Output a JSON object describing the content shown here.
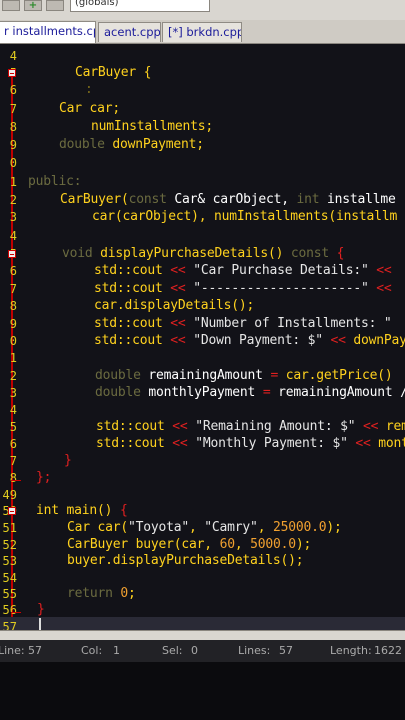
{
  "toolbar": {
    "globals_label": "(globals)"
  },
  "tabs": [
    {
      "label": "r installments.cpp",
      "active": true
    },
    {
      "label": "acent.cpp",
      "active": false
    },
    {
      "label": "[*] brkdn.cpp",
      "active": false
    }
  ],
  "lines": [
    {
      "num": "4",
      "fold": false
    },
    {
      "num": "5",
      "fold": true
    },
    {
      "num": "6",
      "fold": false
    },
    {
      "num": "7",
      "fold": false
    },
    {
      "num": "8",
      "fold": false
    },
    {
      "num": "9",
      "fold": false
    },
    {
      "num": "0",
      "fold": false
    },
    {
      "num": "1",
      "fold": false
    },
    {
      "num": "2",
      "fold": false
    },
    {
      "num": "3",
      "fold": false
    },
    {
      "num": "4",
      "fold": false
    },
    {
      "num": "5",
      "fold": true
    },
    {
      "num": "6",
      "fold": false
    },
    {
      "num": "7",
      "fold": false
    },
    {
      "num": "8",
      "fold": false
    },
    {
      "num": "9",
      "fold": false
    },
    {
      "num": "0",
      "fold": false
    },
    {
      "num": "1",
      "fold": false
    },
    {
      "num": "2",
      "fold": false
    },
    {
      "num": "3",
      "fold": false
    },
    {
      "num": "4",
      "fold": false
    },
    {
      "num": "5",
      "fold": false
    },
    {
      "num": "6",
      "fold": false
    },
    {
      "num": "7",
      "fold": false
    },
    {
      "num": "8",
      "fold": false
    },
    {
      "num": "49",
      "fold": false
    },
    {
      "num": "50",
      "fold": true
    },
    {
      "num": "51",
      "fold": false
    },
    {
      "num": "52",
      "fold": false
    },
    {
      "num": "53",
      "fold": false
    },
    {
      "num": "54",
      "fold": false
    },
    {
      "num": "55",
      "fold": false
    },
    {
      "num": "56",
      "fold": false
    },
    {
      "num": "57",
      "fold": false
    }
  ],
  "code": {
    "l5": "CarBuyer {",
    "l6": ":",
    "l7_type": "Car",
    "l7_var": "car;",
    "l8": "numInstallments;",
    "l9_dim": "double",
    "l9": "downPayment;",
    "l11": "public:",
    "l12_a": "CarBuyer(",
    "l12_b": "const",
    "l12_c": "Car&",
    "l12_d": "carObject,",
    "l12_e": "int",
    "l12_f": "installme",
    "l13": "car(carObject), numInstallments(installm",
    "l15_a": "void",
    "l15_b": "displayPurchaseDetails()",
    "l15_c": "const",
    "l15_d": "{",
    "l16_s": "\"Car Purchase Details:\"",
    "l17_s": "\"---------------------\"",
    "l18": "car.displayDetails();",
    "l19_s": "\"Number of Installments: \"",
    "l20_s": "\"Down Payment: $\"",
    "l20_t": "downPay",
    "l22_a": "double",
    "l22_b": "remainingAmount",
    "l22_c": "car.getPrice()",
    "l23_a": "double",
    "l23_b": "monthlyPayment",
    "l23_c": "remainingAmount /",
    "l25_s": "\"Remaining Amount: $\"",
    "l25_t": "rem",
    "l26_s": "\"Monthly Payment: $\"",
    "l26_t": "mont",
    "l27": "}",
    "l28": "};",
    "l30_a": "int",
    "l30_b": "main()",
    "l30_c": "{",
    "l31_a": "Car car(",
    "l31_s1": "\"Toyota\"",
    "l31_s2": "\"Camry\"",
    "l31_n": "25000.0",
    "l31_e": ");",
    "l32_a": "CarBuyer buyer(car,",
    "l32_n1": "60",
    "l32_n2": "5000.0",
    "l32_e": ");",
    "l33": "buyer.displayPurchaseDetails();",
    "l35_a": "return",
    "l35_n": "0",
    "l35_e": ";",
    "l36": "}",
    "std": "std::cout",
    "op": "<<"
  },
  "status": {
    "line_label": "Line:",
    "line_value": "57",
    "col_label": "Col:",
    "col_value": "1",
    "sel_label": "Sel:",
    "sel_value": "0",
    "lines_label": "Lines:",
    "lines_value": "57",
    "length_label": "Length:",
    "length_value": "1622"
  },
  "colors": {
    "keyword": "#ffd21e",
    "operator": "#e02020",
    "number": "#f0a030",
    "line_number": "#e0cc20",
    "fold_marker": "#c00000"
  }
}
